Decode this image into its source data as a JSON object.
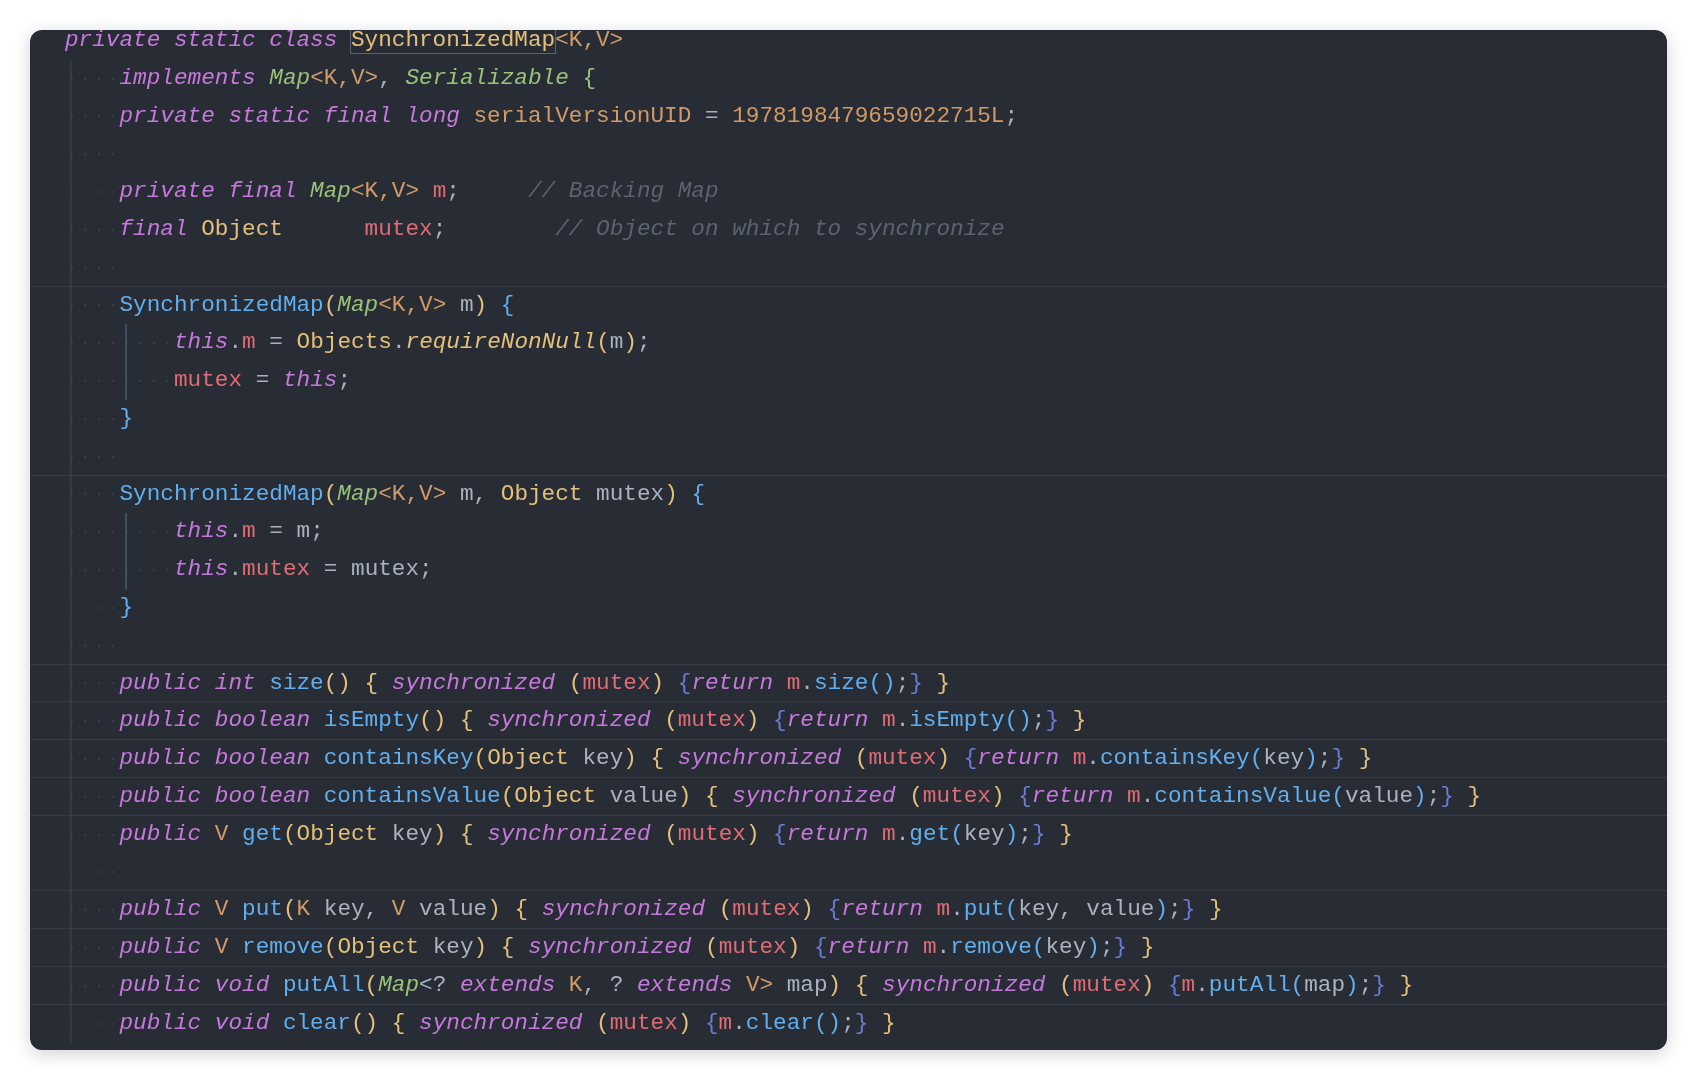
{
  "editor": {
    "lines": [
      {
        "kind": "code",
        "separator": false,
        "tokens": [
          {
            "text": "private static class ",
            "kind": "keyword"
          },
          {
            "text": "SynchronizedMap",
            "kind": "matched"
          },
          {
            "text": "<K,V>",
            "kind": "typeparam"
          }
        ],
        "children": [
          {
            "kind": "code",
            "separator": false,
            "tokens": [
              {
                "text": "implements ",
                "kind": "keyword"
              },
              {
                "text": "Map",
                "kind": "iface"
              },
              {
                "text": "<K,V>",
                "kind": "typeparam"
              },
              {
                "text": ", ",
                "kind": "plain"
              },
              {
                "text": "Serializable ",
                "kind": "iface"
              },
              {
                "text": "{",
                "kind": "brace"
              }
            ]
          },
          {
            "kind": "code",
            "separator": false,
            "tokens": [
              {
                "text": "private static final long ",
                "kind": "keyword"
              },
              {
                "text": "serialVersionUID",
                "kind": "constant"
              },
              {
                "text": " = ",
                "kind": "plain"
              },
              {
                "text": "1978198479659022715L",
                "kind": "number"
              },
              {
                "text": ";",
                "kind": "plain"
              }
            ]
          },
          {
            "kind": "blank",
            "separator": false
          },
          {
            "kind": "code",
            "separator": false,
            "tokens": [
              {
                "text": "private final ",
                "kind": "keyword"
              },
              {
                "text": "Map",
                "kind": "iface"
              },
              {
                "text": "<K,V>",
                "kind": "typeparam"
              },
              {
                "text": " m",
                "kind": "field"
              },
              {
                "text": ";     ",
                "kind": "plain"
              },
              {
                "text": "// Backing Map",
                "kind": "comment"
              }
            ]
          },
          {
            "kind": "code",
            "separator": false,
            "tokens": [
              {
                "text": "final ",
                "kind": "keyword"
              },
              {
                "text": "Object",
                "kind": "class"
              },
              {
                "text": "      mutex",
                "kind": "field"
              },
              {
                "text": ";        ",
                "kind": "plain"
              },
              {
                "text": "// Object on which to synchronize",
                "kind": "comment"
              }
            ]
          },
          {
            "kind": "blank",
            "separator": false
          },
          {
            "kind": "code",
            "separator": true,
            "tokens": [
              {
                "text": "SynchronizedMap",
                "kind": "method"
              },
              {
                "text": "(",
                "kind": "paren"
              },
              {
                "text": "Map",
                "kind": "iface"
              },
              {
                "text": "<K,V>",
                "kind": "typeparam"
              },
              {
                "text": " m",
                "kind": "plain"
              },
              {
                "text": ") ",
                "kind": "paren"
              },
              {
                "text": "{",
                "kind": "block"
              }
            ],
            "children": [
              {
                "kind": "code",
                "separator": false,
                "tokens": [
                  {
                    "text": "this",
                    "kind": "keyword"
                  },
                  {
                    "text": ".",
                    "kind": "plain"
                  },
                  {
                    "text": "m",
                    "kind": "field"
                  },
                  {
                    "text": " = ",
                    "kind": "plain"
                  },
                  {
                    "text": "Objects",
                    "kind": "class"
                  },
                  {
                    "text": ".",
                    "kind": "plain"
                  },
                  {
                    "text": "requireNonNull",
                    "kind": "static"
                  },
                  {
                    "text": "(",
                    "kind": "paren"
                  },
                  {
                    "text": "m",
                    "kind": "plain"
                  },
                  {
                    "text": ")",
                    "kind": "paren"
                  },
                  {
                    "text": ";",
                    "kind": "plain"
                  }
                ]
              },
              {
                "kind": "code",
                "separator": false,
                "tokens": [
                  {
                    "text": "mutex",
                    "kind": "field"
                  },
                  {
                    "text": " = ",
                    "kind": "plain"
                  },
                  {
                    "text": "this",
                    "kind": "keyword"
                  },
                  {
                    "text": ";",
                    "kind": "plain"
                  }
                ]
              }
            ]
          },
          {
            "kind": "code",
            "separator": false,
            "tokens": [
              {
                "text": "}",
                "kind": "block"
              }
            ]
          },
          {
            "kind": "blank",
            "separator": false
          },
          {
            "kind": "code",
            "separator": true,
            "tokens": [
              {
                "text": "SynchronizedMap",
                "kind": "method"
              },
              {
                "text": "(",
                "kind": "paren"
              },
              {
                "text": "Map",
                "kind": "iface"
              },
              {
                "text": "<K,V>",
                "kind": "typeparam"
              },
              {
                "text": " m, ",
                "kind": "plain"
              },
              {
                "text": "Object",
                "kind": "class"
              },
              {
                "text": " mutex",
                "kind": "plain"
              },
              {
                "text": ") ",
                "kind": "paren"
              },
              {
                "text": "{",
                "kind": "block"
              }
            ],
            "children": [
              {
                "kind": "code",
                "separator": false,
                "tokens": [
                  {
                    "text": "this",
                    "kind": "keyword"
                  },
                  {
                    "text": ".",
                    "kind": "plain"
                  },
                  {
                    "text": "m",
                    "kind": "field"
                  },
                  {
                    "text": " = m;",
                    "kind": "plain"
                  }
                ]
              },
              {
                "kind": "code",
                "separator": false,
                "tokens": [
                  {
                    "text": "this",
                    "kind": "keyword"
                  },
                  {
                    "text": ".",
                    "kind": "plain"
                  },
                  {
                    "text": "mutex",
                    "kind": "field"
                  },
                  {
                    "text": " = mutex;",
                    "kind": "plain"
                  }
                ]
              }
            ]
          },
          {
            "kind": "code",
            "separator": false,
            "tokens": [
              {
                "text": "}",
                "kind": "block"
              }
            ]
          },
          {
            "kind": "blank",
            "separator": false
          },
          {
            "kind": "code",
            "separator": true,
            "tokens": [
              {
                "text": "public int ",
                "kind": "keyword"
              },
              {
                "text": "size",
                "kind": "method"
              },
              {
                "text": "() { ",
                "kind": "paren"
              },
              {
                "text": "synchronized ",
                "kind": "keyword"
              },
              {
                "text": "(",
                "kind": "paren"
              },
              {
                "text": "mutex",
                "kind": "field"
              },
              {
                "text": ") ",
                "kind": "paren"
              },
              {
                "text": "{",
                "kind": "inner"
              },
              {
                "text": "return ",
                "kind": "keyword"
              },
              {
                "text": "m",
                "kind": "field"
              },
              {
                "text": ".",
                "kind": "plain"
              },
              {
                "text": "size",
                "kind": "method"
              },
              {
                "text": "()",
                "kind": "block"
              },
              {
                "text": ";",
                "kind": "plain"
              },
              {
                "text": "} ",
                "kind": "inner"
              },
              {
                "text": "}",
                "kind": "paren"
              }
            ]
          },
          {
            "kind": "code",
            "separator": true,
            "tokens": [
              {
                "text": "public boolean ",
                "kind": "keyword"
              },
              {
                "text": "isEmpty",
                "kind": "method"
              },
              {
                "text": "() { ",
                "kind": "paren"
              },
              {
                "text": "synchronized ",
                "kind": "keyword"
              },
              {
                "text": "(",
                "kind": "paren"
              },
              {
                "text": "mutex",
                "kind": "field"
              },
              {
                "text": ") ",
                "kind": "paren"
              },
              {
                "text": "{",
                "kind": "inner"
              },
              {
                "text": "return ",
                "kind": "keyword"
              },
              {
                "text": "m",
                "kind": "field"
              },
              {
                "text": ".",
                "kind": "plain"
              },
              {
                "text": "isEmpty",
                "kind": "method"
              },
              {
                "text": "()",
                "kind": "block"
              },
              {
                "text": ";",
                "kind": "plain"
              },
              {
                "text": "} ",
                "kind": "inner"
              },
              {
                "text": "}",
                "kind": "paren"
              }
            ]
          },
          {
            "kind": "code",
            "separator": true,
            "tokens": [
              {
                "text": "public boolean ",
                "kind": "keyword"
              },
              {
                "text": "containsKey",
                "kind": "method"
              },
              {
                "text": "(",
                "kind": "paren"
              },
              {
                "text": "Object",
                "kind": "class"
              },
              {
                "text": " key",
                "kind": "plain"
              },
              {
                "text": ") { ",
                "kind": "paren"
              },
              {
                "text": "synchronized ",
                "kind": "keyword"
              },
              {
                "text": "(",
                "kind": "paren"
              },
              {
                "text": "mutex",
                "kind": "field"
              },
              {
                "text": ") ",
                "kind": "paren"
              },
              {
                "text": "{",
                "kind": "inner"
              },
              {
                "text": "return ",
                "kind": "keyword"
              },
              {
                "text": "m",
                "kind": "field"
              },
              {
                "text": ".",
                "kind": "plain"
              },
              {
                "text": "containsKey",
                "kind": "method"
              },
              {
                "text": "(",
                "kind": "block"
              },
              {
                "text": "key",
                "kind": "plain"
              },
              {
                "text": ")",
                "kind": "block"
              },
              {
                "text": ";",
                "kind": "plain"
              },
              {
                "text": "} ",
                "kind": "inner"
              },
              {
                "text": "}",
                "kind": "paren"
              }
            ]
          },
          {
            "kind": "code",
            "separator": true,
            "tokens": [
              {
                "text": "public boolean ",
                "kind": "keyword"
              },
              {
                "text": "containsValue",
                "kind": "method"
              },
              {
                "text": "(",
                "kind": "paren"
              },
              {
                "text": "Object",
                "kind": "class"
              },
              {
                "text": " value",
                "kind": "plain"
              },
              {
                "text": ") { ",
                "kind": "paren"
              },
              {
                "text": "synchronized ",
                "kind": "keyword"
              },
              {
                "text": "(",
                "kind": "paren"
              },
              {
                "text": "mutex",
                "kind": "field"
              },
              {
                "text": ") ",
                "kind": "paren"
              },
              {
                "text": "{",
                "kind": "inner"
              },
              {
                "text": "return ",
                "kind": "keyword"
              },
              {
                "text": "m",
                "kind": "field"
              },
              {
                "text": ".",
                "kind": "plain"
              },
              {
                "text": "containsValue",
                "kind": "method"
              },
              {
                "text": "(",
                "kind": "block"
              },
              {
                "text": "value",
                "kind": "plain"
              },
              {
                "text": ")",
                "kind": "block"
              },
              {
                "text": ";",
                "kind": "plain"
              },
              {
                "text": "} ",
                "kind": "inner"
              },
              {
                "text": "}",
                "kind": "paren"
              }
            ]
          },
          {
            "kind": "code",
            "separator": true,
            "tokens": [
              {
                "text": "public ",
                "kind": "keyword"
              },
              {
                "text": "V ",
                "kind": "typeparam"
              },
              {
                "text": "get",
                "kind": "method"
              },
              {
                "text": "(",
                "kind": "paren"
              },
              {
                "text": "Object",
                "kind": "class"
              },
              {
                "text": " key",
                "kind": "plain"
              },
              {
                "text": ") { ",
                "kind": "paren"
              },
              {
                "text": "synchronized ",
                "kind": "keyword"
              },
              {
                "text": "(",
                "kind": "paren"
              },
              {
                "text": "mutex",
                "kind": "field"
              },
              {
                "text": ") ",
                "kind": "paren"
              },
              {
                "text": "{",
                "kind": "inner"
              },
              {
                "text": "return ",
                "kind": "keyword"
              },
              {
                "text": "m",
                "kind": "field"
              },
              {
                "text": ".",
                "kind": "plain"
              },
              {
                "text": "get",
                "kind": "method"
              },
              {
                "text": "(",
                "kind": "block"
              },
              {
                "text": "key",
                "kind": "plain"
              },
              {
                "text": ")",
                "kind": "block"
              },
              {
                "text": ";",
                "kind": "plain"
              },
              {
                "text": "} ",
                "kind": "inner"
              },
              {
                "text": "}",
                "kind": "paren"
              }
            ]
          },
          {
            "kind": "blank",
            "separator": false
          },
          {
            "kind": "code",
            "separator": true,
            "tokens": [
              {
                "text": "public ",
                "kind": "keyword"
              },
              {
                "text": "V ",
                "kind": "typeparam"
              },
              {
                "text": "put",
                "kind": "method"
              },
              {
                "text": "(",
                "kind": "paren"
              },
              {
                "text": "K",
                "kind": "typeparam"
              },
              {
                "text": " key, ",
                "kind": "plain"
              },
              {
                "text": "V",
                "kind": "typeparam"
              },
              {
                "text": " value",
                "kind": "plain"
              },
              {
                "text": ") { ",
                "kind": "paren"
              },
              {
                "text": "synchronized ",
                "kind": "keyword"
              },
              {
                "text": "(",
                "kind": "paren"
              },
              {
                "text": "mutex",
                "kind": "field"
              },
              {
                "text": ") ",
                "kind": "paren"
              },
              {
                "text": "{",
                "kind": "inner"
              },
              {
                "text": "return ",
                "kind": "keyword"
              },
              {
                "text": "m",
                "kind": "field"
              },
              {
                "text": ".",
                "kind": "plain"
              },
              {
                "text": "put",
                "kind": "method"
              },
              {
                "text": "(",
                "kind": "block"
              },
              {
                "text": "key, value",
                "kind": "plain"
              },
              {
                "text": ")",
                "kind": "block"
              },
              {
                "text": ";",
                "kind": "plain"
              },
              {
                "text": "} ",
                "kind": "inner"
              },
              {
                "text": "}",
                "kind": "paren"
              }
            ]
          },
          {
            "kind": "code",
            "separator": true,
            "tokens": [
              {
                "text": "public ",
                "kind": "keyword"
              },
              {
                "text": "V ",
                "kind": "typeparam"
              },
              {
                "text": "remove",
                "kind": "method"
              },
              {
                "text": "(",
                "kind": "paren"
              },
              {
                "text": "Object",
                "kind": "class"
              },
              {
                "text": " key",
                "kind": "plain"
              },
              {
                "text": ") { ",
                "kind": "paren"
              },
              {
                "text": "synchronized ",
                "kind": "keyword"
              },
              {
                "text": "(",
                "kind": "paren"
              },
              {
                "text": "mutex",
                "kind": "field"
              },
              {
                "text": ") ",
                "kind": "paren"
              },
              {
                "text": "{",
                "kind": "inner"
              },
              {
                "text": "return ",
                "kind": "keyword"
              },
              {
                "text": "m",
                "kind": "field"
              },
              {
                "text": ".",
                "kind": "plain"
              },
              {
                "text": "remove",
                "kind": "method"
              },
              {
                "text": "(",
                "kind": "block"
              },
              {
                "text": "key",
                "kind": "plain"
              },
              {
                "text": ")",
                "kind": "block"
              },
              {
                "text": ";",
                "kind": "plain"
              },
              {
                "text": "} ",
                "kind": "inner"
              },
              {
                "text": "}",
                "kind": "paren"
              }
            ]
          },
          {
            "kind": "code",
            "separator": true,
            "tokens": [
              {
                "text": "public void ",
                "kind": "keyword"
              },
              {
                "text": "putAll",
                "kind": "method"
              },
              {
                "text": "(",
                "kind": "paren"
              },
              {
                "text": "Map",
                "kind": "iface"
              },
              {
                "text": "<? ",
                "kind": "plain"
              },
              {
                "text": "extends ",
                "kind": "keyword"
              },
              {
                "text": "K",
                "kind": "typeparam"
              },
              {
                "text": ", ? ",
                "kind": "plain"
              },
              {
                "text": "extends ",
                "kind": "keyword"
              },
              {
                "text": "V>",
                "kind": "typeparam"
              },
              {
                "text": " map",
                "kind": "plain"
              },
              {
                "text": ") { ",
                "kind": "paren"
              },
              {
                "text": "synchronized ",
                "kind": "keyword"
              },
              {
                "text": "(",
                "kind": "paren"
              },
              {
                "text": "mutex",
                "kind": "field"
              },
              {
                "text": ") ",
                "kind": "paren"
              },
              {
                "text": "{",
                "kind": "inner"
              },
              {
                "text": "m",
                "kind": "field"
              },
              {
                "text": ".",
                "kind": "plain"
              },
              {
                "text": "putAll",
                "kind": "method"
              },
              {
                "text": "(",
                "kind": "block"
              },
              {
                "text": "map",
                "kind": "plain"
              },
              {
                "text": ")",
                "kind": "block"
              },
              {
                "text": ";",
                "kind": "plain"
              },
              {
                "text": "} ",
                "kind": "inner"
              },
              {
                "text": "}",
                "kind": "paren"
              }
            ]
          },
          {
            "kind": "code",
            "separator": true,
            "tokens": [
              {
                "text": "public void ",
                "kind": "keyword"
              },
              {
                "text": "clear",
                "kind": "method"
              },
              {
                "text": "() { ",
                "kind": "paren"
              },
              {
                "text": "synchronized ",
                "kind": "keyword"
              },
              {
                "text": "(",
                "kind": "paren"
              },
              {
                "text": "mutex",
                "kind": "field"
              },
              {
                "text": ") ",
                "kind": "paren"
              },
              {
                "text": "{",
                "kind": "inner"
              },
              {
                "text": "m",
                "kind": "field"
              },
              {
                "text": ".",
                "kind": "plain"
              },
              {
                "text": "clear",
                "kind": "method"
              },
              {
                "text": "()",
                "kind": "block"
              },
              {
                "text": ";",
                "kind": "plain"
              },
              {
                "text": "} ",
                "kind": "inner"
              },
              {
                "text": "}",
                "kind": "paren"
              }
            ]
          }
        ]
      }
    ]
  }
}
